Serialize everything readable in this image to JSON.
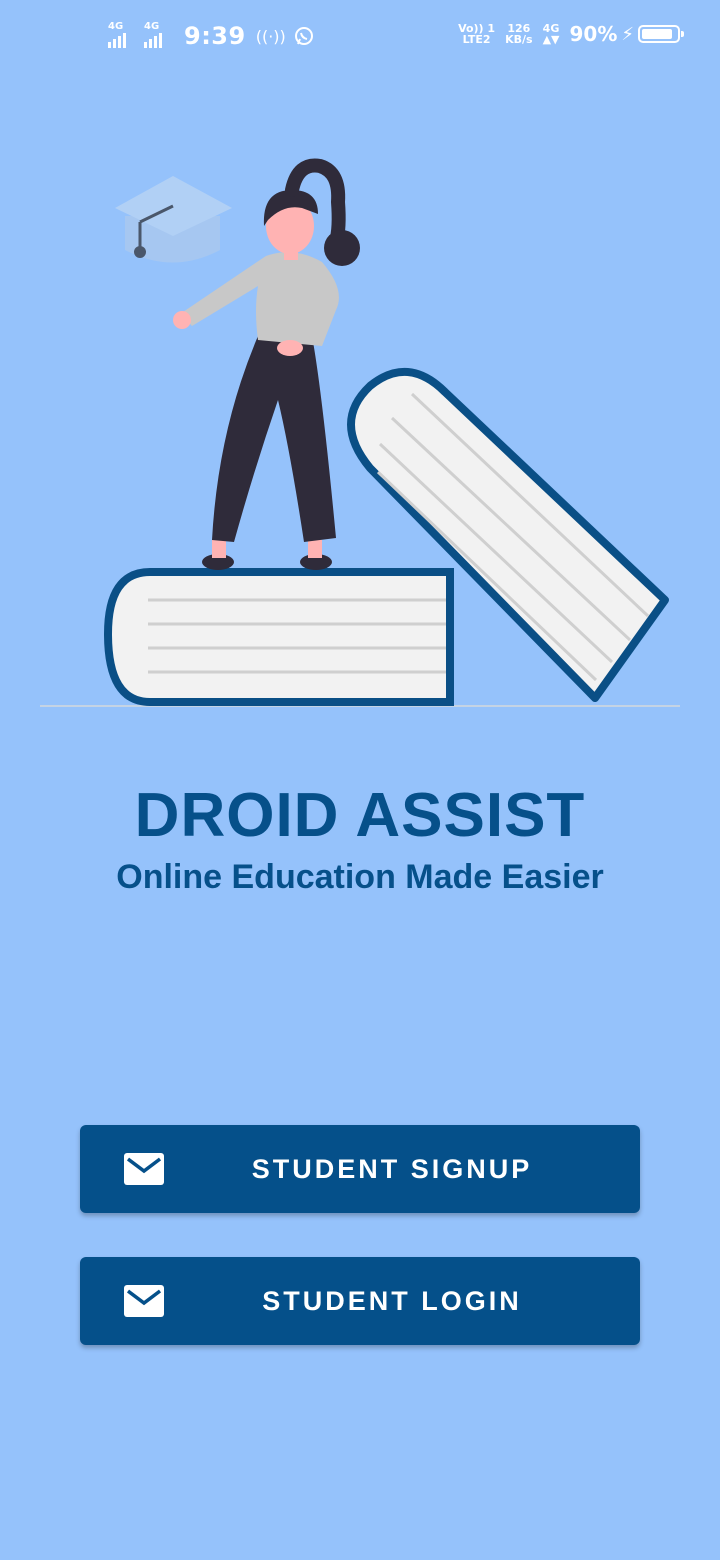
{
  "status_bar": {
    "network1": "4G",
    "network2": "4G",
    "time": "9:39",
    "volte_line1": "Vo)) 1",
    "volte_line2": "LTE2",
    "speed_value": "126",
    "speed_unit": "KB/s",
    "network3": "4G",
    "battery_percent": "90%",
    "icons": [
      "signal-icon",
      "signal-icon",
      "hotspot-icon",
      "whatsapp-icon",
      "signal-icon",
      "charging-icon",
      "battery-icon"
    ]
  },
  "hero": {
    "illustration": "student-standing-on-books-illustration",
    "colors": {
      "book_outline": "#0a4f86",
      "pages": "#f2f2f2",
      "hair_and_pants": "#2f2b3a",
      "shirt": "#c8c8c8",
      "skin": "#ffb3b3",
      "cap": "#a9c9f0"
    }
  },
  "app": {
    "title": "DROID ASSIST",
    "tagline": "Online Education Made Easier"
  },
  "buttons": {
    "signup_label": "STUDENT SIGNUP",
    "login_label": "STUDENT LOGIN",
    "icon": "mail-icon"
  },
  "theme": {
    "background": "#95c2fb",
    "primary": "#05508a",
    "text_on_primary": "#ffffff"
  }
}
